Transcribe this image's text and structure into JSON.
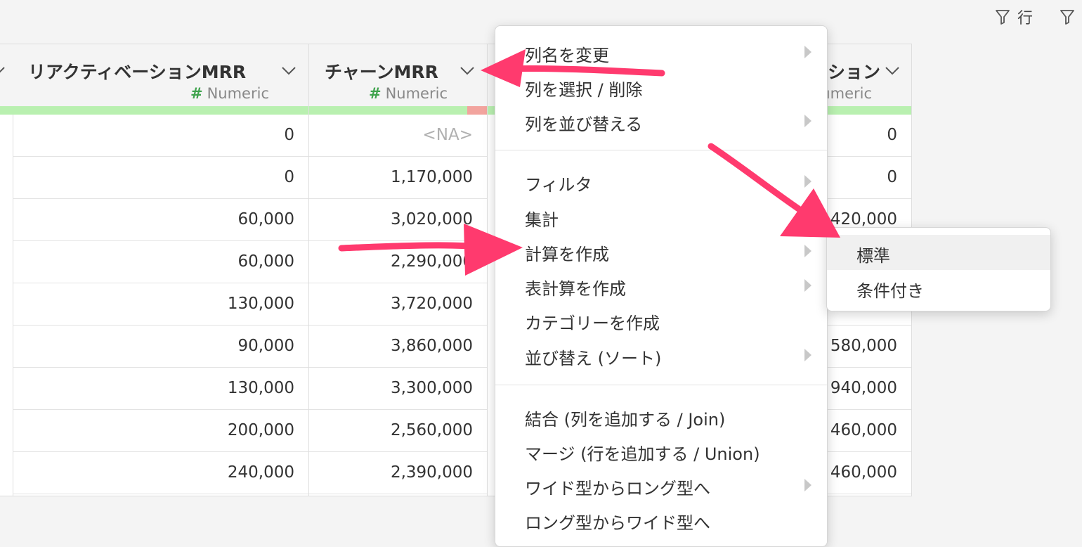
{
  "toolbar": {
    "row_filter_label": "行"
  },
  "columns": [
    {
      "name": "",
      "type": "",
      "values": [
        "",
        "",
        "",
        "",
        "",
        "",
        "",
        "",
        ""
      ]
    },
    {
      "name": "リアクティベーションMRR",
      "type": "Numeric",
      "values": [
        "0",
        "0",
        "60,000",
        "60,000",
        "130,000",
        "90,000",
        "130,000",
        "200,000",
        "240,000"
      ]
    },
    {
      "name": "チャーンMRR",
      "type": "Numeric",
      "values": [
        "<NA>",
        "1,170,000",
        "3,020,000",
        "2,290,000",
        "3,720,000",
        "3,860,000",
        "3,300,000",
        "2,560,000",
        "2,390,000"
      ]
    },
    {
      "name": "",
      "type": "",
      "values": [
        "",
        "",
        "",
        "",
        "",
        "",
        "",
        "",
        ""
      ]
    },
    {
      "name": "ション",
      "type": "umeric",
      "values": [
        "0",
        "0",
        "420,000",
        "",
        "",
        "",
        "580,000",
        "940,000",
        "460,000",
        "460,000"
      ]
    }
  ],
  "context_menu": {
    "items": [
      {
        "label": "列名を変更",
        "submenu": true
      },
      {
        "label": "列を選択 / 削除",
        "submenu": false
      },
      {
        "label": "列を並び替える",
        "submenu": true
      },
      {
        "label": "フィルタ",
        "submenu": true
      },
      {
        "label": "集計",
        "submenu": false
      },
      {
        "label": "計算を作成",
        "submenu": true
      },
      {
        "label": "表計算を作成",
        "submenu": true
      },
      {
        "label": "カテゴリーを作成",
        "submenu": false
      },
      {
        "label": "並び替え (ソート)",
        "submenu": true
      },
      {
        "label": "結合 (列を追加する / Join)",
        "submenu": false
      },
      {
        "label": "マージ (行を追加する / Union)",
        "submenu": false
      },
      {
        "label": "ワイド型からロング型へ",
        "submenu": true
      },
      {
        "label": "ロング型からワイド型へ",
        "submenu": false
      }
    ]
  },
  "submenu": {
    "items": [
      {
        "label": "標準"
      },
      {
        "label": "条件付き"
      }
    ]
  },
  "colors": {
    "annotation_arrow": "#ff3a6e",
    "quality_good": "#b9f0b0",
    "quality_bad": "#f2a49e",
    "type_hash": "#3fa34d"
  }
}
